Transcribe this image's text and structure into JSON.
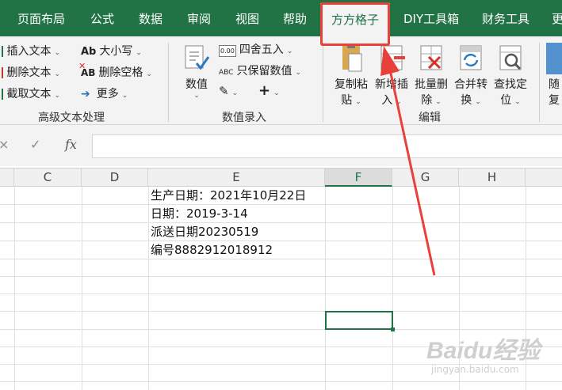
{
  "tabs": [
    {
      "label": "页面布局",
      "active": false
    },
    {
      "label": "公式",
      "active": false
    },
    {
      "label": "数据",
      "active": false
    },
    {
      "label": "审阅",
      "active": false
    },
    {
      "label": "视图",
      "active": false
    },
    {
      "label": "帮助",
      "active": false
    },
    {
      "label": "方方格子",
      "active": true
    },
    {
      "label": "DIY工具箱",
      "active": false
    },
    {
      "label": "财务工具",
      "active": false
    },
    {
      "label": "更",
      "active": false
    }
  ],
  "ribbon": {
    "text_group": {
      "insert_text": "插入文本",
      "delete_text": "删除文本",
      "extract_text": "截取文本",
      "case_icon_text": "Ab",
      "case": "大小写",
      "delete_space_icon_text": "AB",
      "delete_space": "删除空格",
      "more": "更多",
      "label": "高级文本处理"
    },
    "number_group": {
      "value_label": "数值",
      "round_icon_text": "0.00",
      "round": "四舍五入",
      "keep_icon_text": "ABC",
      "keep_numeric": "只保留数值",
      "label": "数值录入"
    },
    "edit_group": {
      "copy_paste_line1": "复制粘",
      "copy_paste_line2": "贴",
      "new_insert_line1": "新增插",
      "new_insert_line2": "入",
      "batch_delete_line1": "批量删",
      "batch_delete_line2": "除",
      "merge_convert_line1": "合并转",
      "merge_convert_line2": "换",
      "find_locate_line1": "查找定",
      "find_locate_line2": "位",
      "label": "编辑"
    },
    "random_group": {
      "line1": "随",
      "line2": "复"
    }
  },
  "formula_bar": {
    "cancel": "×",
    "confirm": "✓",
    "fx": "fx"
  },
  "columns": [
    "C",
    "D",
    "E",
    "F",
    "G",
    "H"
  ],
  "selected_column": "F",
  "cells": [
    "生产日期：2021年10月22日",
    "日期：2019-3-14",
    "派送日期20230519",
    "编号8882912018912"
  ],
  "watermark": {
    "logo": "Baidu经验",
    "sub": "jingyan.baidu.com"
  },
  "colors": {
    "accent": "#217346",
    "highlight": "#e8413a"
  }
}
